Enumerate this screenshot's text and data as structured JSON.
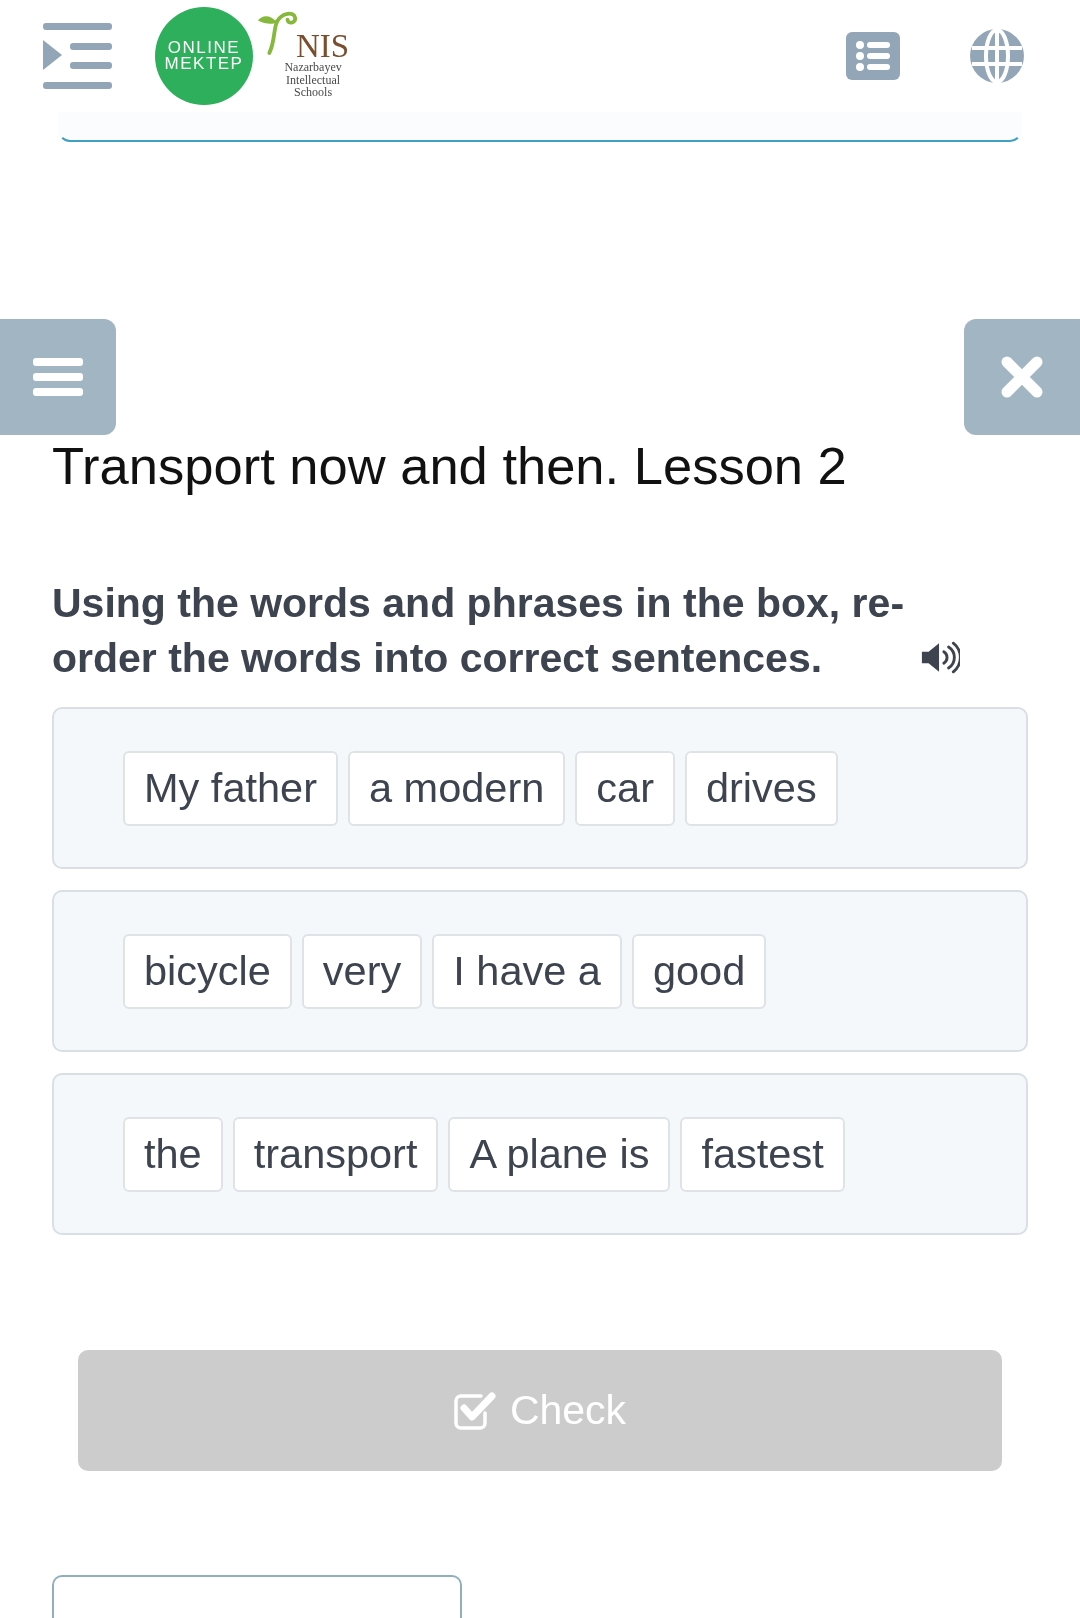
{
  "header": {
    "logo": {
      "lines": [
        "ONLINE",
        "MEKTEP"
      ]
    },
    "partner_logo": {
      "name": "NIS",
      "lines": [
        "Nazarbayev",
        "Intellectual",
        "Schools"
      ]
    }
  },
  "lesson_title": "Transport now and then. Lesson 2",
  "instruction": "Using the words and phrases in the box, re-order the words into correct sentences.",
  "rows": [
    {
      "tiles": [
        "My father",
        "a modern",
        "car",
        "drives"
      ]
    },
    {
      "tiles": [
        "bicycle",
        "very",
        "I have a",
        "good"
      ]
    },
    {
      "tiles": [
        "the",
        "transport",
        "A plane is",
        "fastest"
      ]
    }
  ],
  "check_button": {
    "label": "Check",
    "disabled": true
  }
}
